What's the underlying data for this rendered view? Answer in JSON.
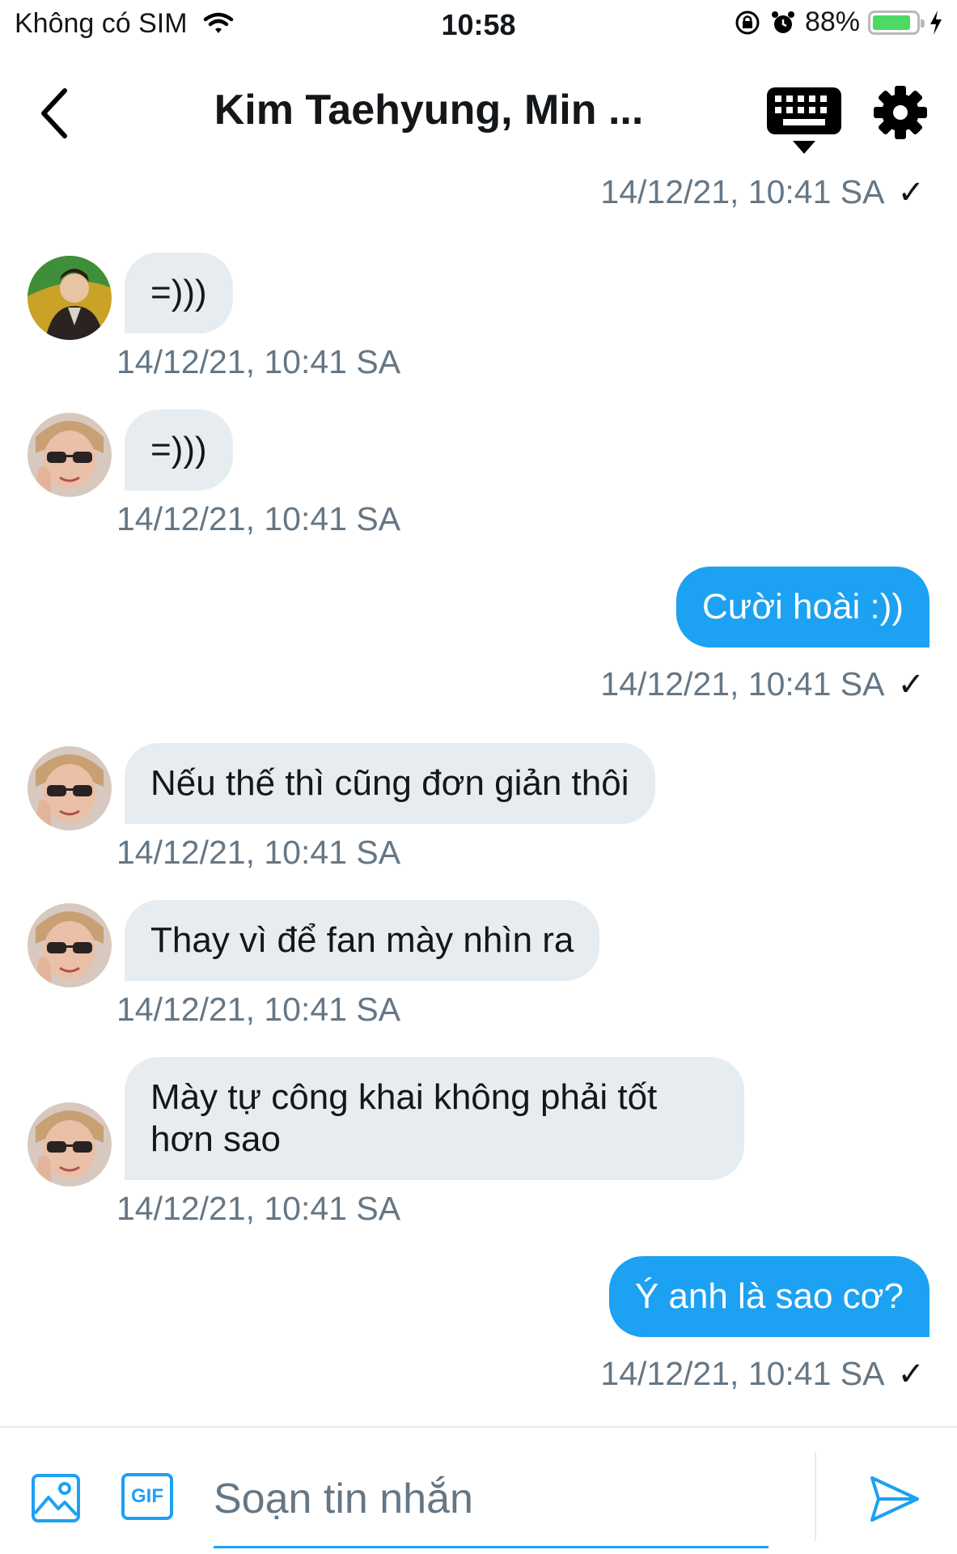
{
  "status_bar": {
    "carrier": "Không có SIM",
    "time": "10:58",
    "battery_percent": "88%",
    "battery_level": 0.88
  },
  "header": {
    "title": "Kim Taehyung, Min ...",
    "back_icon": "chevron-left-icon",
    "keyboard_icon": "keyboard-icon",
    "settings_icon": "gear-icon"
  },
  "messages": [
    {
      "direction": "out",
      "text": "",
      "timestamp": "14/12/21, 10:41 SA",
      "read": "✓"
    },
    {
      "direction": "in",
      "sender_avatar": "avatar-1",
      "text": "=)))",
      "timestamp": "14/12/21, 10:41 SA"
    },
    {
      "direction": "in",
      "sender_avatar": "avatar-2",
      "text": "=)))",
      "timestamp": "14/12/21, 10:41 SA"
    },
    {
      "direction": "out",
      "text": "Cười hoài :))",
      "timestamp": "14/12/21, 10:41 SA",
      "read": "✓"
    },
    {
      "direction": "in",
      "sender_avatar": "avatar-2",
      "text": "Nếu thế thì cũng đơn giản thôi",
      "timestamp": "14/12/21, 10:41 SA"
    },
    {
      "direction": "in",
      "sender_avatar": "avatar-2",
      "text": "Thay vì để fan mày nhìn ra",
      "timestamp": "14/12/21, 10:41 SA"
    },
    {
      "direction": "in",
      "sender_avatar": "avatar-2",
      "text": "Mày tự công khai không phải tốt hơn sao",
      "timestamp": "14/12/21, 10:41 SA"
    },
    {
      "direction": "out",
      "text": "Ý anh là sao cơ?",
      "timestamp": "14/12/21, 10:41 SA",
      "read": "✓"
    }
  ],
  "composer": {
    "placeholder": "Soạn tin nhắn",
    "gif_label": "GIF",
    "image_icon": "image-icon",
    "send_icon": "send-icon"
  },
  "colors": {
    "accent": "#1da1f2",
    "incoming_bubble": "#e6ecf0",
    "timestamp": "#657786",
    "battery": "#4cd964"
  }
}
